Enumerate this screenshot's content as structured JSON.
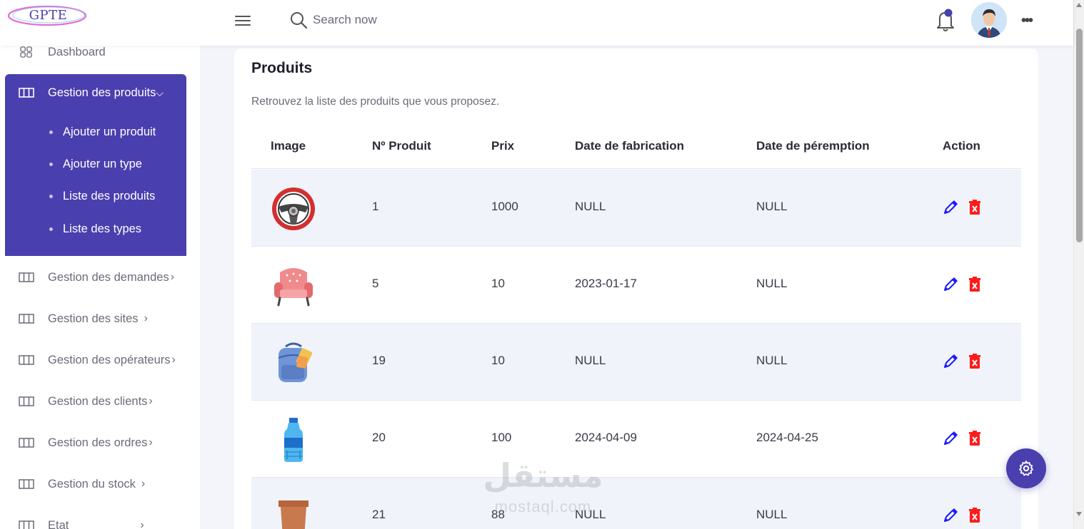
{
  "header": {
    "logo": "GPTE",
    "search_placeholder": "Search now",
    "more": "•••"
  },
  "sidebar": {
    "dashboard": "Dashboard",
    "active_group": {
      "label": "Gestion des produits",
      "chevron": "⌵",
      "items": [
        "Ajouter un produit",
        "Ajouter un type",
        "Liste des produits",
        "Liste des types"
      ]
    },
    "items": [
      {
        "label": "Gestion des demandes",
        "chevron": "›"
      },
      {
        "label": "Gestion des sites",
        "chevron": "›"
      },
      {
        "label": "Gestion des opérateurs",
        "chevron": "›"
      },
      {
        "label": "Gestion des clients",
        "chevron": "›"
      },
      {
        "label": "Gestion des ordres",
        "chevron": "›"
      },
      {
        "label": "Gestion du stock",
        "chevron": "›"
      },
      {
        "label": "Etat",
        "chevron": "›"
      }
    ]
  },
  "main": {
    "title": "Produits",
    "subtitle": "Retrouvez la liste des produits que vous proposez.",
    "columns": [
      "Image",
      "Nº Produit",
      "Prix",
      "Date de fabrication",
      "Date de péremption",
      "Action"
    ],
    "rows": [
      {
        "image": "steering-wheel",
        "num": "1",
        "prix": "1000",
        "fabrication": "NULL",
        "peremption": "NULL"
      },
      {
        "image": "armchair",
        "num": "5",
        "prix": "10",
        "fabrication": "2023-01-17",
        "peremption": "NULL"
      },
      {
        "image": "backpack",
        "num": "19",
        "prix": "10",
        "fabrication": "NULL",
        "peremption": "NULL"
      },
      {
        "image": "water-bottle",
        "num": "20",
        "prix": "100",
        "fabrication": "2024-04-09",
        "peremption": "2024-04-25"
      },
      {
        "image": "flower-pot",
        "num": "21",
        "prix": "88",
        "fabrication": "NULL",
        "peremption": "NULL"
      }
    ]
  },
  "watermark": {
    "arabic": "مستقل",
    "latin": "mostaql.com"
  },
  "colors": {
    "accent": "#4a3fae",
    "edit": "#1a1aff",
    "delete": "#ff1a1a",
    "row_alt": "#f1f3fa"
  }
}
